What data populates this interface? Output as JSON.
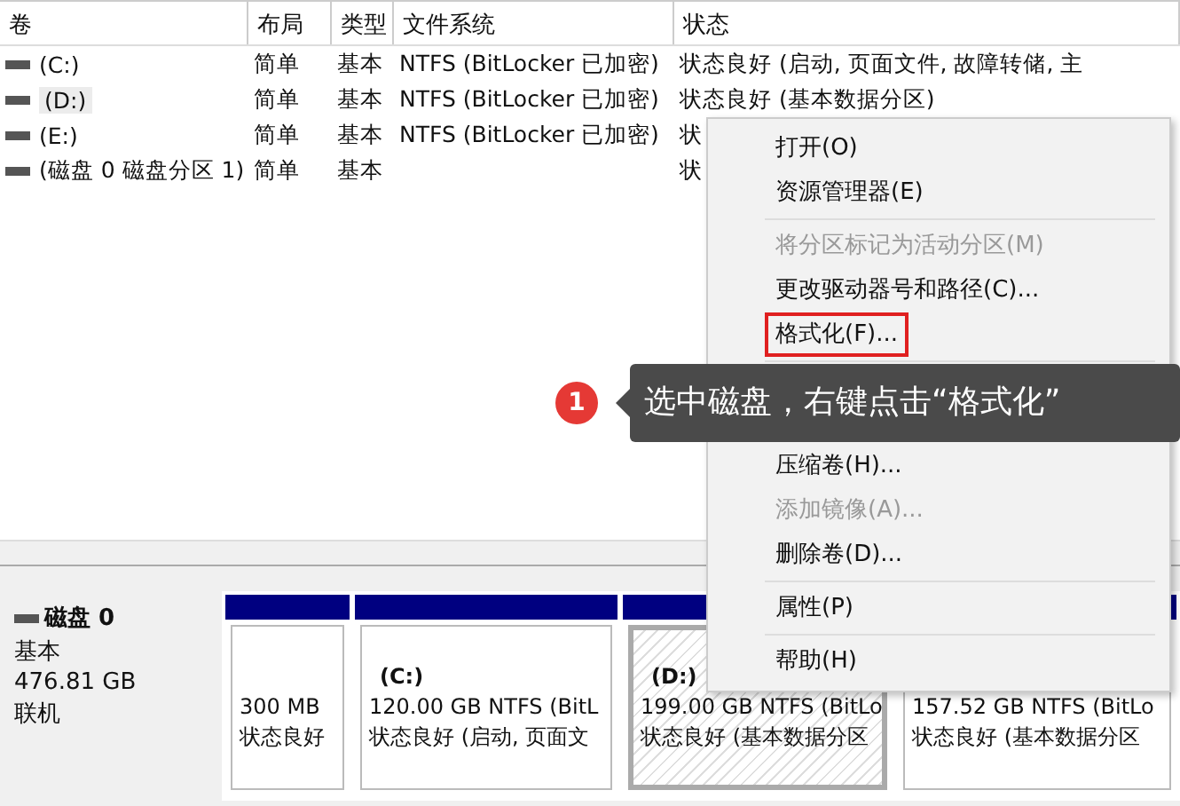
{
  "table": {
    "columns": [
      "卷",
      "布局",
      "类型",
      "文件系统",
      "状态"
    ],
    "rows": [
      {
        "cells": [
          "(C:)",
          "简单",
          "基本",
          "NTFS (BitLocker 已加密)",
          "状态良好 (启动, 页面文件, 故障转储, 主"
        ],
        "selected": false
      },
      {
        "cells": [
          "(D:)",
          "简单",
          "基本",
          "NTFS (BitLocker 已加密)",
          "状态良好 (基本数据分区)"
        ],
        "selected": true
      },
      {
        "cells": [
          "(E:)",
          "简单",
          "基本",
          "NTFS (BitLocker 已加密)",
          "状"
        ],
        "selected": false
      },
      {
        "cells": [
          "(磁盘 0 磁盘分区 1)",
          "简单",
          "基本",
          "",
          "状"
        ],
        "selected": false
      }
    ]
  },
  "disk": {
    "name": "磁盘 0",
    "type": "基本",
    "size": "476.81 GB",
    "status": "联机",
    "partitions": [
      {
        "size": "300 MB",
        "status": "状态良好",
        "selected": false
      },
      {
        "label": "(C:)",
        "size": "120.00 GB NTFS (BitL",
        "status": "状态良好 (启动, 页面文",
        "selected": false
      },
      {
        "label": "(D:)",
        "size": "199.00 GB NTFS (BitLo",
        "status": "状态良好 (基本数据分区",
        "selected": true
      },
      {
        "size": "157.52 GB NTFS (BitLo",
        "status": "状态良好 (基本数据分区",
        "selected": false
      }
    ]
  },
  "context_menu": {
    "groups": [
      [
        {
          "label": "打开(O)",
          "disabled": false,
          "highlighted": false
        },
        {
          "label": "资源管理器(E)",
          "disabled": false,
          "highlighted": false
        }
      ],
      [
        {
          "label": "将分区标记为活动分区(M)",
          "disabled": true,
          "highlighted": false
        },
        {
          "label": "更改驱动器号和路径(C)...",
          "disabled": false,
          "highlighted": false
        },
        {
          "label": "格式化(F)...",
          "disabled": false,
          "highlighted": true
        }
      ],
      [
        {
          "label": "压缩卷(H)...",
          "disabled": false,
          "highlighted": false
        },
        {
          "label": "添加镜像(A)...",
          "disabled": true,
          "highlighted": false
        },
        {
          "label": "删除卷(D)...",
          "disabled": false,
          "highlighted": false
        }
      ],
      [
        {
          "label": "属性(P)",
          "disabled": false,
          "highlighted": false
        }
      ],
      [
        {
          "label": "帮助(H)",
          "disabled": false,
          "highlighted": false
        }
      ]
    ]
  },
  "callout": {
    "step": "1",
    "text": "选中磁盘，右键点击“格式化”"
  }
}
